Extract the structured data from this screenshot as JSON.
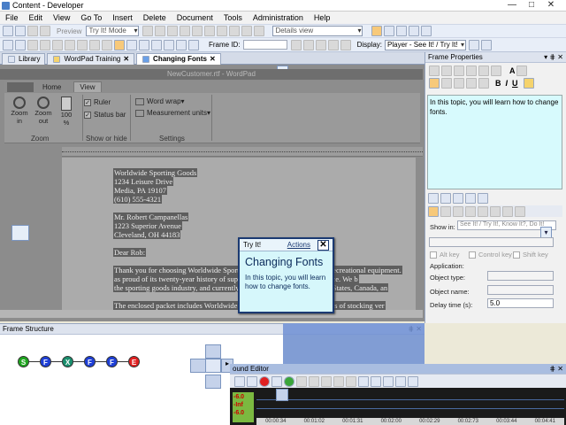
{
  "app": {
    "title": "Content - Developer"
  },
  "menu": [
    "File",
    "Edit",
    "View",
    "Go To",
    "Insert",
    "Delete",
    "Document",
    "Tools",
    "Administration",
    "Help"
  ],
  "toolbar": {
    "preview_label": "Preview",
    "mode_select": "Try It! Mode",
    "view_select": "Details view",
    "frame_id_label": "Frame ID:",
    "display_label": "Display:",
    "display_select": "Player - See It! / Try It!"
  },
  "tabs": [
    {
      "label": "Library"
    },
    {
      "label": "WordPad Training"
    },
    {
      "label": "Changing Fonts"
    }
  ],
  "wordpad": {
    "title": "NewCustomer.rtf - WordPad",
    "tabs": [
      "Home",
      "View"
    ],
    "zoom_in": "Zoom in",
    "zoom_out": "Zoom out",
    "zoom_100": "100 %",
    "group_zoom": "Zoom",
    "ruler_label": "Ruler",
    "status_bar_label": "Status bar",
    "group_show": "Show or hide",
    "word_wrap": "Word wrap",
    "measurement_units": "Measurement units",
    "group_settings": "Settings"
  },
  "document": {
    "lines": [
      "Worldwide Sporting Goods",
      "1234 Leisure Drive",
      "Media, PA 19107",
      "(610) 555-4321",
      "",
      "Mr. Robert Campanellas",
      "1223 Superior Avenue",
      "Cleveland, OH  44183",
      "",
      "Dear Rob:",
      "",
      "Thank you for choosing Worldwide Sporting Goods as your supplier of recreational equipment.",
      "as proud of its twenty-year history of supplying excellent customer service. We b",
      "the sporting goods industry, and currently serve customers in the United States, Canada, an",
      "",
      "The enclosed packet includes Worldwide Sporting Goods lists the benefits of stocking ver"
    ]
  },
  "callout": {
    "mode": "Try It!",
    "actions": "Actions",
    "heading": "Changing Fonts",
    "body": "In this topic, you will learn how to change fonts."
  },
  "frame_properties": {
    "title": "Frame Properties",
    "text": "In this topic, you will learn how to change fonts.",
    "show_in_label": "Show in:",
    "show_in_value": "See It! / Try It!, Know It?, Do It!",
    "alt_key": "Alt key",
    "control_key": "Control key",
    "shift_key": "Shift key",
    "application": "Application:",
    "object_type": "Object type:",
    "object_name": "Object name:",
    "delay_label": "Delay time (s):",
    "delay_value": "5.0"
  },
  "frame_structure": {
    "title": "Frame Structure",
    "nodes": [
      {
        "label": "S",
        "color": "#1fa51f"
      },
      {
        "label": "F",
        "color": "#1e3fd6"
      },
      {
        "label": "X",
        "color": "#1a8f6e"
      },
      {
        "label": "F",
        "color": "#1e3fd6"
      },
      {
        "label": "F",
        "color": "#1e3fd6"
      },
      {
        "label": "E",
        "color": "#e02020"
      }
    ]
  },
  "sound_editor": {
    "title": "ound Editor",
    "levels": [
      "-6.0",
      "-Inf",
      "-6.0"
    ],
    "times": [
      "00:00:34",
      "00:01:02",
      "00:01:31",
      "00:02:00",
      "00:02:29",
      "00:02:73",
      "00:03:44",
      "00:04:41"
    ]
  }
}
